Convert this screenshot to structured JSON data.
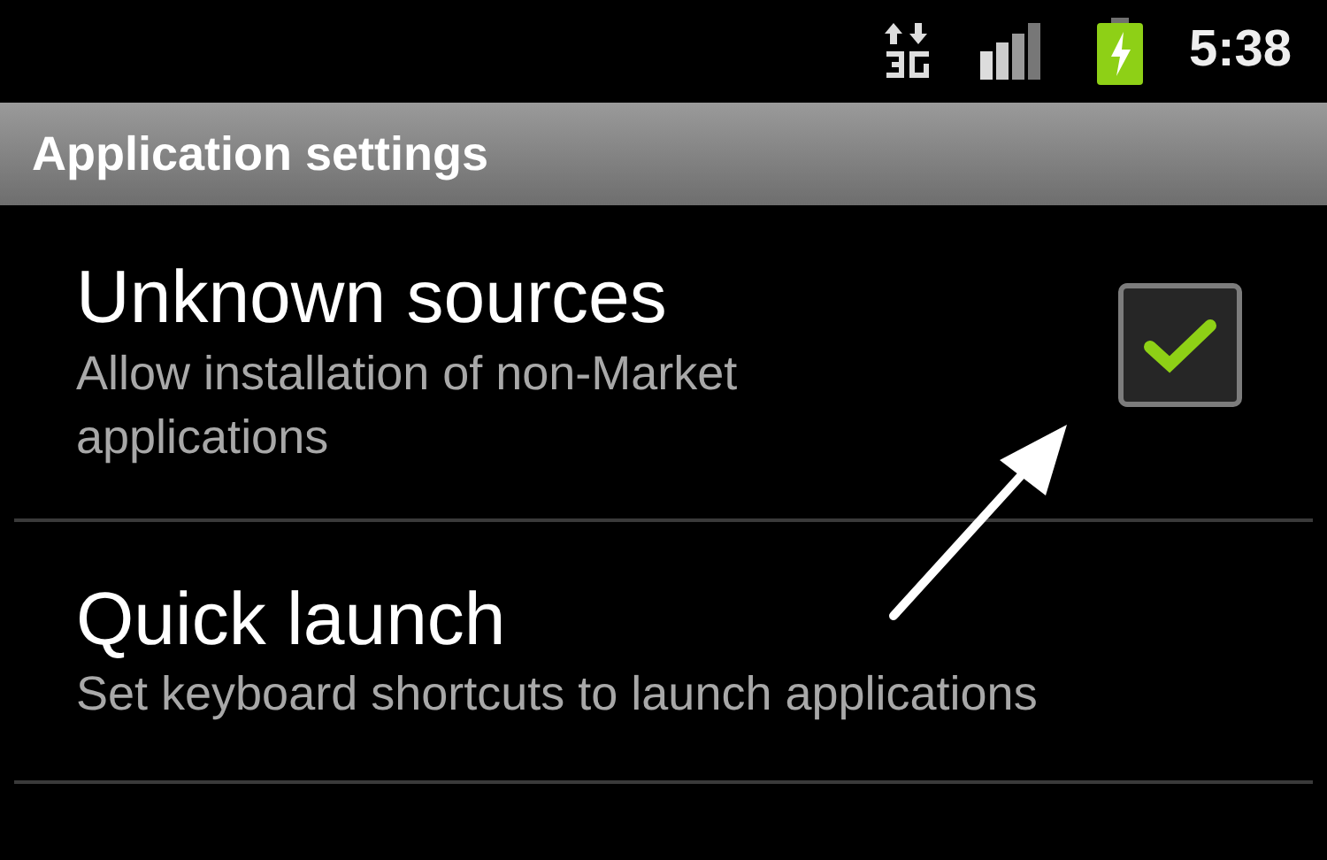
{
  "status_bar": {
    "time": "5:38"
  },
  "header": {
    "title": "Application settings"
  },
  "items": [
    {
      "kind": "checkbox",
      "title": "Unknown sources",
      "summary": "Allow installation of non-Market applications",
      "checked": true
    },
    {
      "kind": "plain",
      "title": "Quick launch",
      "summary": "Set keyboard shortcuts to launch applications"
    }
  ]
}
